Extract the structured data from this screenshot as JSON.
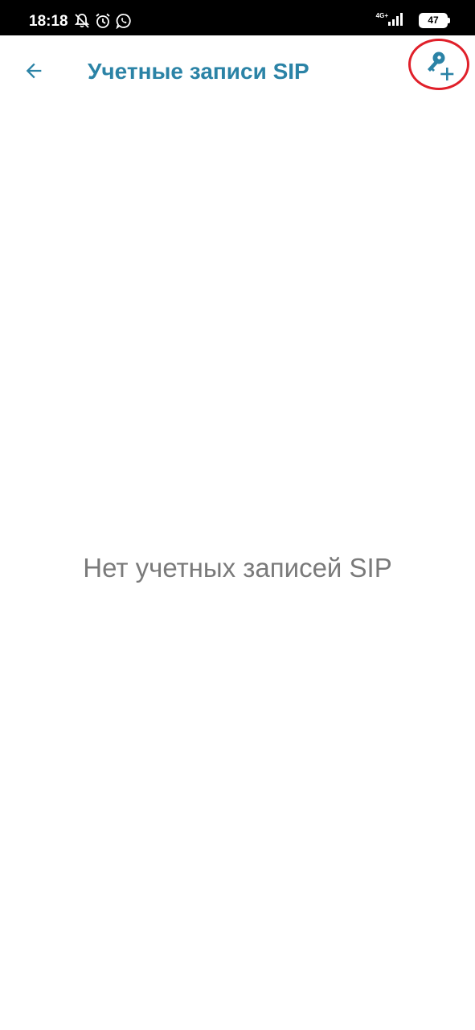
{
  "status_bar": {
    "time": "18:18",
    "network_type": "4G+",
    "battery_level": "47",
    "icons": [
      "notifications-off-icon",
      "alarm-icon",
      "whatsapp-icon",
      "signal-icon"
    ]
  },
  "app_bar": {
    "title": "Учетные записи SIP",
    "back_icon": "arrow-back-icon",
    "add_icon": "key-add-icon"
  },
  "content": {
    "empty_message": "Нет учетных записей SIP"
  },
  "colors": {
    "accent": "#2b83a6",
    "highlight": "#e0202a",
    "empty_text": "#7a7a7a",
    "status_bar": "#000000"
  }
}
